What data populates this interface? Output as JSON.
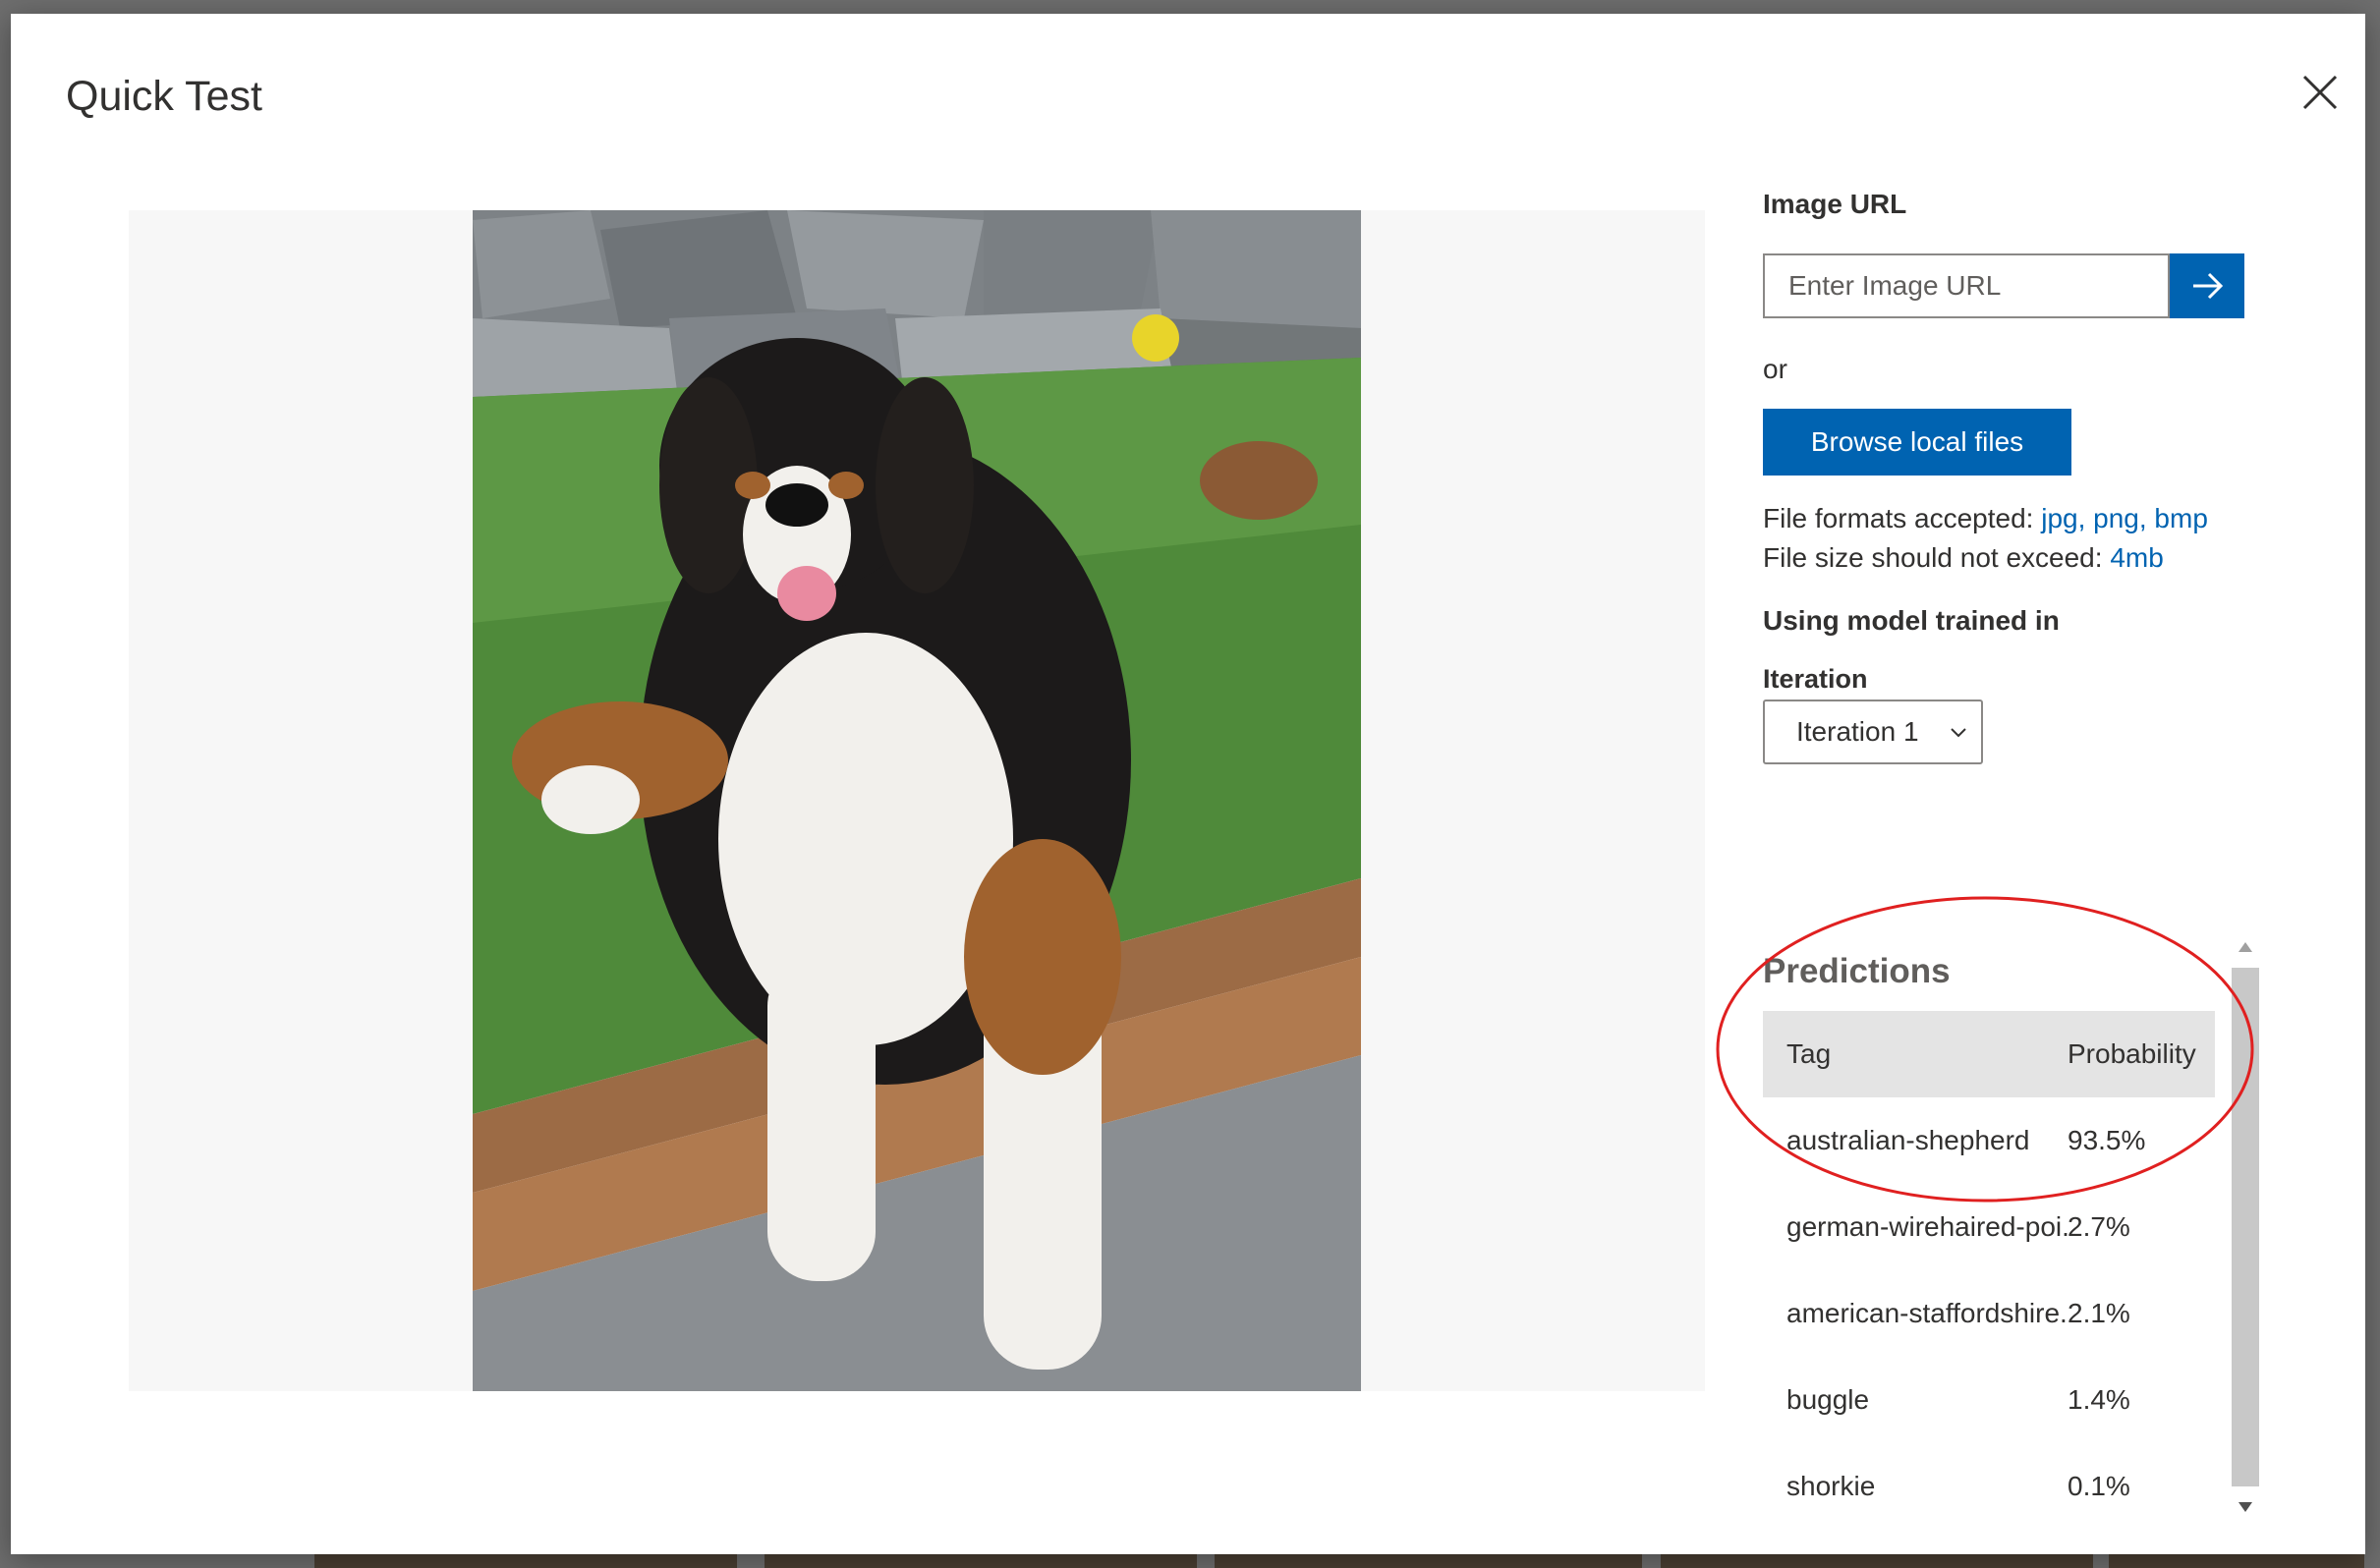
{
  "dialog": {
    "title": "Quick Test"
  },
  "image_url": {
    "label": "Image URL",
    "placeholder": "Enter Image URL"
  },
  "or_text": "or",
  "browse_button": "Browse local files",
  "file_formats": {
    "prefix": "File formats accepted: ",
    "value": "jpg, png, bmp"
  },
  "file_size": {
    "prefix": "File size should not exceed: ",
    "value": "4mb"
  },
  "model": {
    "label": "Using model trained in",
    "iteration_label": "Iteration",
    "iteration_value": "Iteration 1"
  },
  "predictions": {
    "title": "Predictions",
    "columns": [
      "Tag",
      "Probability"
    ],
    "rows": [
      {
        "tag": "australian-shepherd",
        "probability": "93.5%"
      },
      {
        "tag": "german-wirehaired-poi...",
        "probability": "2.7%"
      },
      {
        "tag": "american-staffordshire...",
        "probability": "2.1%"
      },
      {
        "tag": "buggle",
        "probability": "1.4%"
      },
      {
        "tag": "shorkie",
        "probability": "0.1%"
      }
    ]
  },
  "colors": {
    "accent": "#0063b1",
    "annotation": "#e02020"
  },
  "icons": {
    "close": "close-icon",
    "go": "arrow-right-icon",
    "dropdown": "chevron-down-icon"
  }
}
